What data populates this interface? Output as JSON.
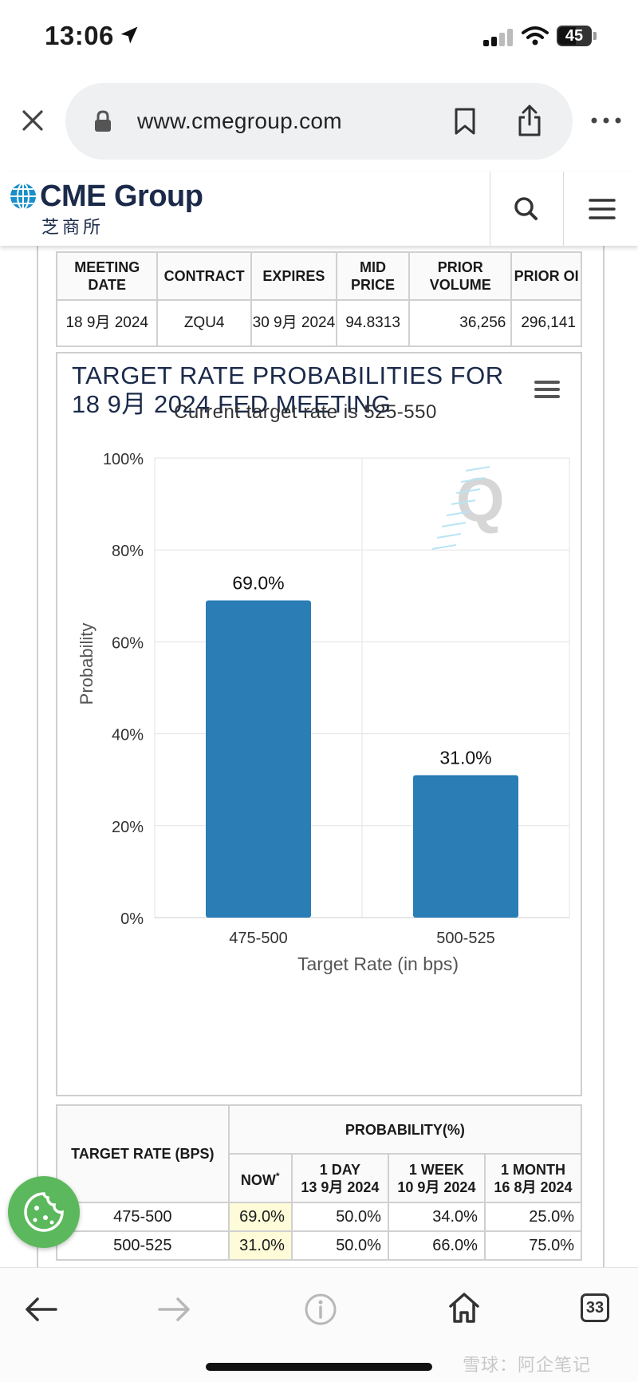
{
  "status_bar": {
    "time": "13:06",
    "battery": "45"
  },
  "browser": {
    "url": "www.cmegroup.com",
    "open_tabs": "33"
  },
  "header": {
    "brand": "CME Group",
    "brand_subtitle": "芝商所"
  },
  "contract_table": {
    "headers": [
      "MEETING DATE",
      "CONTRACT",
      "EXPIRES",
      "MID PRICE",
      "PRIOR VOLUME",
      "PRIOR OI"
    ],
    "row": [
      "18 9月 2024",
      "ZQU4",
      "30 9月 2024",
      "94.8313",
      "36,256",
      "296,141"
    ]
  },
  "chart": {
    "title": "TARGET RATE PROBABILITIES FOR 18 9月 2024 FED MEETING",
    "subtitle": "Current target rate is 525-550"
  },
  "chart_data": {
    "type": "bar",
    "categories": [
      "475-500",
      "500-525"
    ],
    "values": [
      69.0,
      31.0
    ],
    "data_labels": [
      "69.0%",
      "31.0%"
    ],
    "title": "TARGET RATE PROBABILITIES FOR 18 9月 2024 FED MEETING",
    "subtitle": "Current target rate is 525-550",
    "xlabel": "Target Rate (in bps)",
    "ylabel": "Probability",
    "ylim": [
      0,
      100
    ],
    "y_ticks": [
      "0%",
      "20%",
      "40%",
      "60%",
      "80%",
      "100%"
    ],
    "grid": true,
    "bar_color": "#2a7db5"
  },
  "prob_table": {
    "col_target": "TARGET RATE (BPS)",
    "col_prob": "PROBABILITY(%)",
    "sub_headers": [
      {
        "l1": "NOW",
        "l2": ""
      },
      {
        "l1": "1 DAY",
        "l2": "13 9月 2024"
      },
      {
        "l1": "1 WEEK",
        "l2": "10 9月 2024"
      },
      {
        "l1": "1 MONTH",
        "l2": "16 8月 2024"
      }
    ],
    "now_marker": "*",
    "rows": [
      {
        "rate": "475-500",
        "vals": [
          "69.0%",
          "50.0%",
          "34.0%",
          "25.0%"
        ]
      },
      {
        "rate": "500-525",
        "vals": [
          "31.0%",
          "50.0%",
          "66.0%",
          "75.0%"
        ]
      }
    ]
  },
  "watermark": "雪球：阿企笔记"
}
